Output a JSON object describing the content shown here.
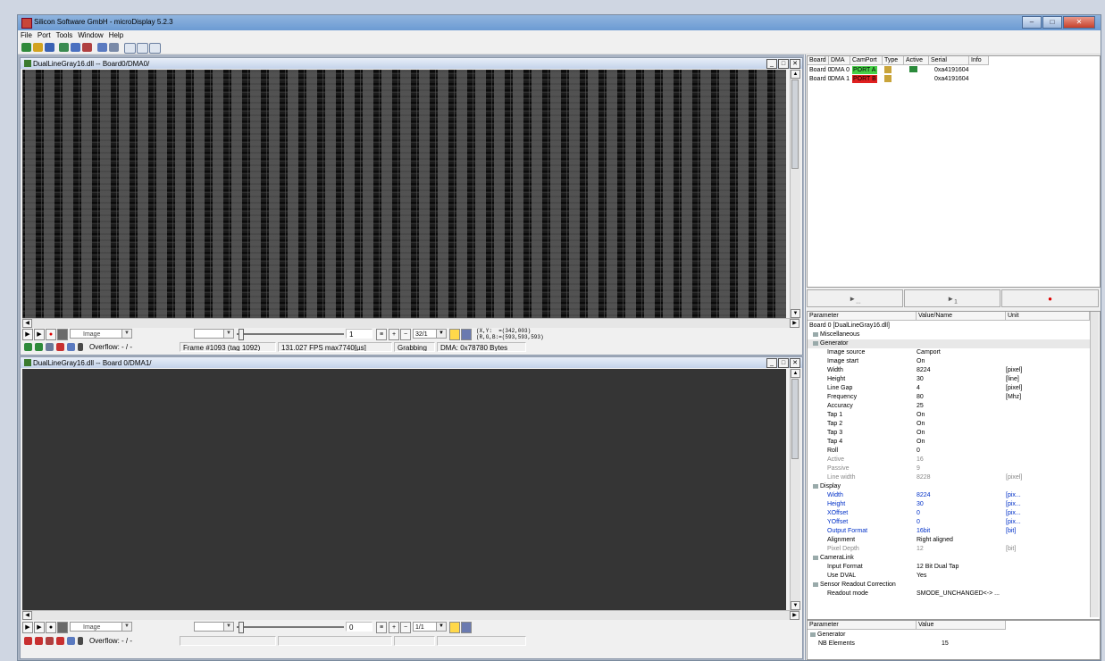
{
  "app": {
    "title": "Silicon Software GmbH - microDisplay 5.2.3"
  },
  "menu": [
    "File",
    "Port",
    "Tools",
    "Window",
    "Help"
  ],
  "window1": {
    "title": "DualLineGray16.dll -- Board0/DMA0/",
    "image_combo": "Image",
    "frame_field": "1",
    "zoom_combo": "32/1",
    "coord_xy": "(X,Y:  =(342,003)",
    "coord_rgb": "(R,G,B:=(593,593,593)",
    "overflow": "Overflow: - / -",
    "frame": "Frame #1093 (tag 1092)",
    "fps": "131.027 FPS max7740[µs]",
    "state": "Grabbing",
    "dma": "DMA: 0x78780 Bytes"
  },
  "window2": {
    "title": "DualLineGray16.dll -- Board 0/DMA1/",
    "image_combo": "Image",
    "frame_field": "0",
    "zoom_combo": "1/1",
    "overflow": "Overflow: - / -"
  },
  "board_table": {
    "headers": [
      "Board",
      "DMA",
      "CamPort",
      "Type",
      "Active",
      "Serial",
      "Info"
    ],
    "rows": [
      {
        "board": "Board 0",
        "dma": "DMA 0",
        "port": "PORT A",
        "serial": "0xa4191604",
        "port_color": "#46d046"
      },
      {
        "board": "Board 0",
        "dma": "DMA 1",
        "port": "PORT B",
        "serial": "0xa4191604",
        "port_color": "#e02020"
      }
    ]
  },
  "params": {
    "headers": {
      "parameter": "Parameter",
      "value": "Value/Name",
      "unit": "Unit"
    },
    "root": "Board 0  [DualLineGray16.dll]",
    "groups": {
      "misc": "Miscellaneous",
      "generator": "Generator",
      "display": "Display",
      "cameralink": "CameraLink",
      "sensor": "Sensor Readout Correction"
    },
    "rows": [
      {
        "name": "Image source",
        "value": "Camport",
        "unit": ""
      },
      {
        "name": "Image start",
        "value": "On",
        "unit": ""
      },
      {
        "name": "Width",
        "value": "8224",
        "unit": "[pixel]"
      },
      {
        "name": "Height",
        "value": "30",
        "unit": "[line]"
      },
      {
        "name": "Line Gap",
        "value": "4",
        "unit": "[pixel]"
      },
      {
        "name": "Frequency",
        "value": "80",
        "unit": "[Mhz]"
      },
      {
        "name": "Accuracy",
        "value": "25",
        "unit": ""
      },
      {
        "name": "Tap 1",
        "value": "On",
        "unit": ""
      },
      {
        "name": "Tap 2",
        "value": "On",
        "unit": ""
      },
      {
        "name": "Tap 3",
        "value": "On",
        "unit": ""
      },
      {
        "name": "Tap 4",
        "value": "On",
        "unit": ""
      },
      {
        "name": "Roll",
        "value": "0",
        "unit": ""
      },
      {
        "name": "Active",
        "value": "16",
        "unit": ""
      },
      {
        "name": "Passive",
        "value": "9",
        "unit": ""
      },
      {
        "name": "Line width",
        "value": "8228",
        "unit": "[pixel]"
      },
      {
        "name": "Width",
        "value": "8224",
        "unit": "[pix..."
      },
      {
        "name": "Height",
        "value": "30",
        "unit": "[pix..."
      },
      {
        "name": "XOffset",
        "value": "0",
        "unit": "[pix..."
      },
      {
        "name": "YOffset",
        "value": "0",
        "unit": "[pix..."
      },
      {
        "name": "Output Format",
        "value": "16bit",
        "unit": "[bit]"
      },
      {
        "name": "Alignment",
        "value": "Right aligned",
        "unit": ""
      },
      {
        "name": "Pixel Depth",
        "value": "12",
        "unit": "[bit]"
      },
      {
        "name": "Input Format",
        "value": "12 Bit Dual Tap",
        "unit": ""
      },
      {
        "name": "Use DVAL",
        "value": "Yes",
        "unit": ""
      },
      {
        "name": "Readout mode",
        "value": "SMODE_UNCHANGED<-> ...",
        "unit": ""
      }
    ]
  },
  "info_panel": {
    "headers": {
      "parameter": "Parameter",
      "value": "Value"
    },
    "group": "Generator",
    "row_name": "NB Elements",
    "row_value": "15"
  },
  "colors": {
    "port_a": "#46d046",
    "port_b": "#e02020",
    "highlight_blue": "#0030c8"
  }
}
